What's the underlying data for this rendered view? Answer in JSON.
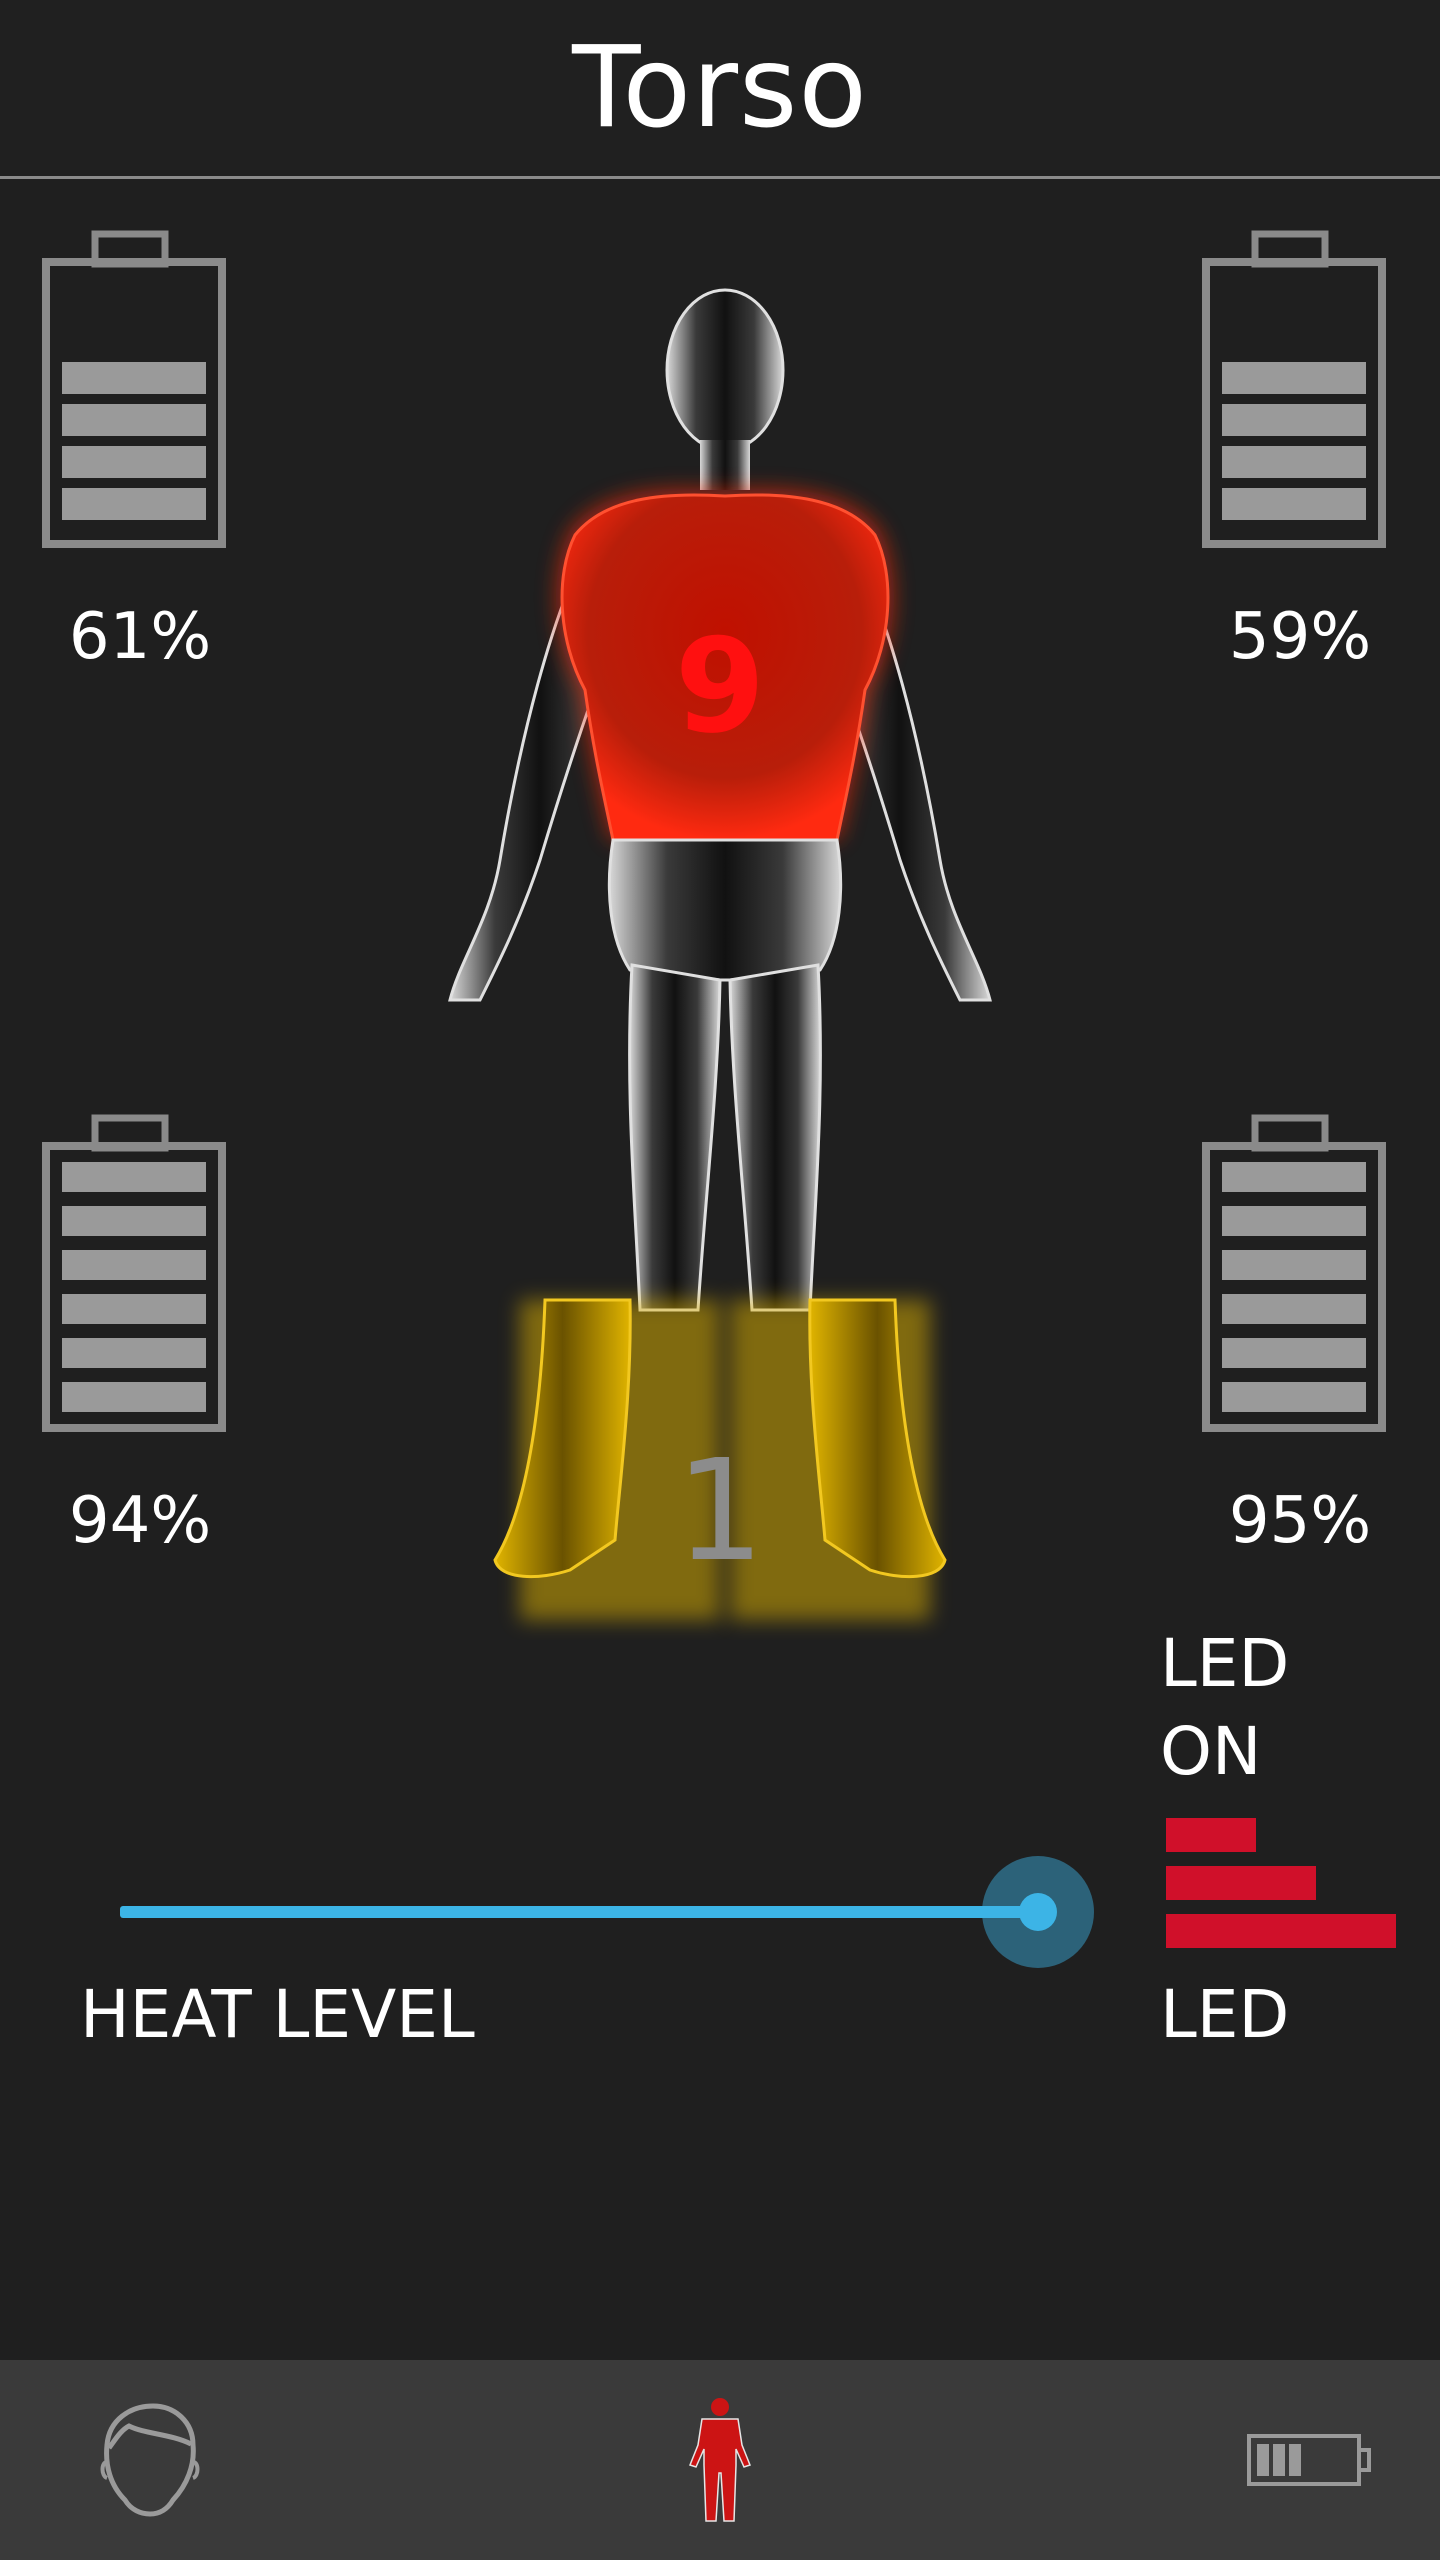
{
  "header": {
    "title": "Torso"
  },
  "batteries": [
    {
      "id": "top-left",
      "percent_label": "61%",
      "level": 0.61,
      "bars": 4
    },
    {
      "id": "top-right",
      "percent_label": "59%",
      "level": 0.59,
      "bars": 4
    },
    {
      "id": "bottom-left",
      "percent_label": "94%",
      "level": 0.94,
      "bars": 6
    },
    {
      "id": "bottom-right",
      "percent_label": "95%",
      "level": 0.95,
      "bars": 6
    }
  ],
  "zones": {
    "torso_level": "9",
    "feet_level": "1"
  },
  "led": {
    "status_line1": "LED",
    "status_line2": "ON",
    "label": "LED",
    "bars_color": "#d0102a"
  },
  "slider": {
    "label": "HEAT LEVEL",
    "value": 1.0,
    "color": "#3cb4e6"
  },
  "nav": {
    "items": [
      {
        "icon": "head-icon",
        "active": false
      },
      {
        "icon": "body-icon",
        "active": true
      },
      {
        "icon": "battery-icon",
        "active": false
      }
    ]
  },
  "colors": {
    "background": "#1f1f1f",
    "torso_heat": "#ff1010",
    "feet_heat": "#e0b400",
    "nav_background": "#3a3a3a"
  }
}
